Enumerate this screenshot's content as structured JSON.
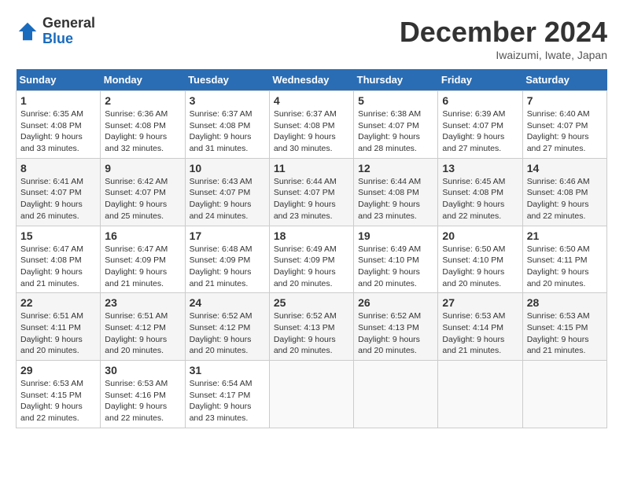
{
  "header": {
    "logo_general": "General",
    "logo_blue": "Blue",
    "month_title": "December 2024",
    "location": "Iwaizumi, Iwate, Japan"
  },
  "weekdays": [
    "Sunday",
    "Monday",
    "Tuesday",
    "Wednesday",
    "Thursday",
    "Friday",
    "Saturday"
  ],
  "weeks": [
    [
      {
        "day": "1",
        "sunrise": "Sunrise: 6:35 AM",
        "sunset": "Sunset: 4:08 PM",
        "daylight": "Daylight: 9 hours and 33 minutes."
      },
      {
        "day": "2",
        "sunrise": "Sunrise: 6:36 AM",
        "sunset": "Sunset: 4:08 PM",
        "daylight": "Daylight: 9 hours and 32 minutes."
      },
      {
        "day": "3",
        "sunrise": "Sunrise: 6:37 AM",
        "sunset": "Sunset: 4:08 PM",
        "daylight": "Daylight: 9 hours and 31 minutes."
      },
      {
        "day": "4",
        "sunrise": "Sunrise: 6:37 AM",
        "sunset": "Sunset: 4:08 PM",
        "daylight": "Daylight: 9 hours and 30 minutes."
      },
      {
        "day": "5",
        "sunrise": "Sunrise: 6:38 AM",
        "sunset": "Sunset: 4:07 PM",
        "daylight": "Daylight: 9 hours and 28 minutes."
      },
      {
        "day": "6",
        "sunrise": "Sunrise: 6:39 AM",
        "sunset": "Sunset: 4:07 PM",
        "daylight": "Daylight: 9 hours and 27 minutes."
      },
      {
        "day": "7",
        "sunrise": "Sunrise: 6:40 AM",
        "sunset": "Sunset: 4:07 PM",
        "daylight": "Daylight: 9 hours and 27 minutes."
      }
    ],
    [
      {
        "day": "8",
        "sunrise": "Sunrise: 6:41 AM",
        "sunset": "Sunset: 4:07 PM",
        "daylight": "Daylight: 9 hours and 26 minutes."
      },
      {
        "day": "9",
        "sunrise": "Sunrise: 6:42 AM",
        "sunset": "Sunset: 4:07 PM",
        "daylight": "Daylight: 9 hours and 25 minutes."
      },
      {
        "day": "10",
        "sunrise": "Sunrise: 6:43 AM",
        "sunset": "Sunset: 4:07 PM",
        "daylight": "Daylight: 9 hours and 24 minutes."
      },
      {
        "day": "11",
        "sunrise": "Sunrise: 6:44 AM",
        "sunset": "Sunset: 4:07 PM",
        "daylight": "Daylight: 9 hours and 23 minutes."
      },
      {
        "day": "12",
        "sunrise": "Sunrise: 6:44 AM",
        "sunset": "Sunset: 4:08 PM",
        "daylight": "Daylight: 9 hours and 23 minutes."
      },
      {
        "day": "13",
        "sunrise": "Sunrise: 6:45 AM",
        "sunset": "Sunset: 4:08 PM",
        "daylight": "Daylight: 9 hours and 22 minutes."
      },
      {
        "day": "14",
        "sunrise": "Sunrise: 6:46 AM",
        "sunset": "Sunset: 4:08 PM",
        "daylight": "Daylight: 9 hours and 22 minutes."
      }
    ],
    [
      {
        "day": "15",
        "sunrise": "Sunrise: 6:47 AM",
        "sunset": "Sunset: 4:08 PM",
        "daylight": "Daylight: 9 hours and 21 minutes."
      },
      {
        "day": "16",
        "sunrise": "Sunrise: 6:47 AM",
        "sunset": "Sunset: 4:09 PM",
        "daylight": "Daylight: 9 hours and 21 minutes."
      },
      {
        "day": "17",
        "sunrise": "Sunrise: 6:48 AM",
        "sunset": "Sunset: 4:09 PM",
        "daylight": "Daylight: 9 hours and 21 minutes."
      },
      {
        "day": "18",
        "sunrise": "Sunrise: 6:49 AM",
        "sunset": "Sunset: 4:09 PM",
        "daylight": "Daylight: 9 hours and 20 minutes."
      },
      {
        "day": "19",
        "sunrise": "Sunrise: 6:49 AM",
        "sunset": "Sunset: 4:10 PM",
        "daylight": "Daylight: 9 hours and 20 minutes."
      },
      {
        "day": "20",
        "sunrise": "Sunrise: 6:50 AM",
        "sunset": "Sunset: 4:10 PM",
        "daylight": "Daylight: 9 hours and 20 minutes."
      },
      {
        "day": "21",
        "sunrise": "Sunrise: 6:50 AM",
        "sunset": "Sunset: 4:11 PM",
        "daylight": "Daylight: 9 hours and 20 minutes."
      }
    ],
    [
      {
        "day": "22",
        "sunrise": "Sunrise: 6:51 AM",
        "sunset": "Sunset: 4:11 PM",
        "daylight": "Daylight: 9 hours and 20 minutes."
      },
      {
        "day": "23",
        "sunrise": "Sunrise: 6:51 AM",
        "sunset": "Sunset: 4:12 PM",
        "daylight": "Daylight: 9 hours and 20 minutes."
      },
      {
        "day": "24",
        "sunrise": "Sunrise: 6:52 AM",
        "sunset": "Sunset: 4:12 PM",
        "daylight": "Daylight: 9 hours and 20 minutes."
      },
      {
        "day": "25",
        "sunrise": "Sunrise: 6:52 AM",
        "sunset": "Sunset: 4:13 PM",
        "daylight": "Daylight: 9 hours and 20 minutes."
      },
      {
        "day": "26",
        "sunrise": "Sunrise: 6:52 AM",
        "sunset": "Sunset: 4:13 PM",
        "daylight": "Daylight: 9 hours and 20 minutes."
      },
      {
        "day": "27",
        "sunrise": "Sunrise: 6:53 AM",
        "sunset": "Sunset: 4:14 PM",
        "daylight": "Daylight: 9 hours and 21 minutes."
      },
      {
        "day": "28",
        "sunrise": "Sunrise: 6:53 AM",
        "sunset": "Sunset: 4:15 PM",
        "daylight": "Daylight: 9 hours and 21 minutes."
      }
    ],
    [
      {
        "day": "29",
        "sunrise": "Sunrise: 6:53 AM",
        "sunset": "Sunset: 4:15 PM",
        "daylight": "Daylight: 9 hours and 22 minutes."
      },
      {
        "day": "30",
        "sunrise": "Sunrise: 6:53 AM",
        "sunset": "Sunset: 4:16 PM",
        "daylight": "Daylight: 9 hours and 22 minutes."
      },
      {
        "day": "31",
        "sunrise": "Sunrise: 6:54 AM",
        "sunset": "Sunset: 4:17 PM",
        "daylight": "Daylight: 9 hours and 23 minutes."
      },
      null,
      null,
      null,
      null
    ]
  ]
}
